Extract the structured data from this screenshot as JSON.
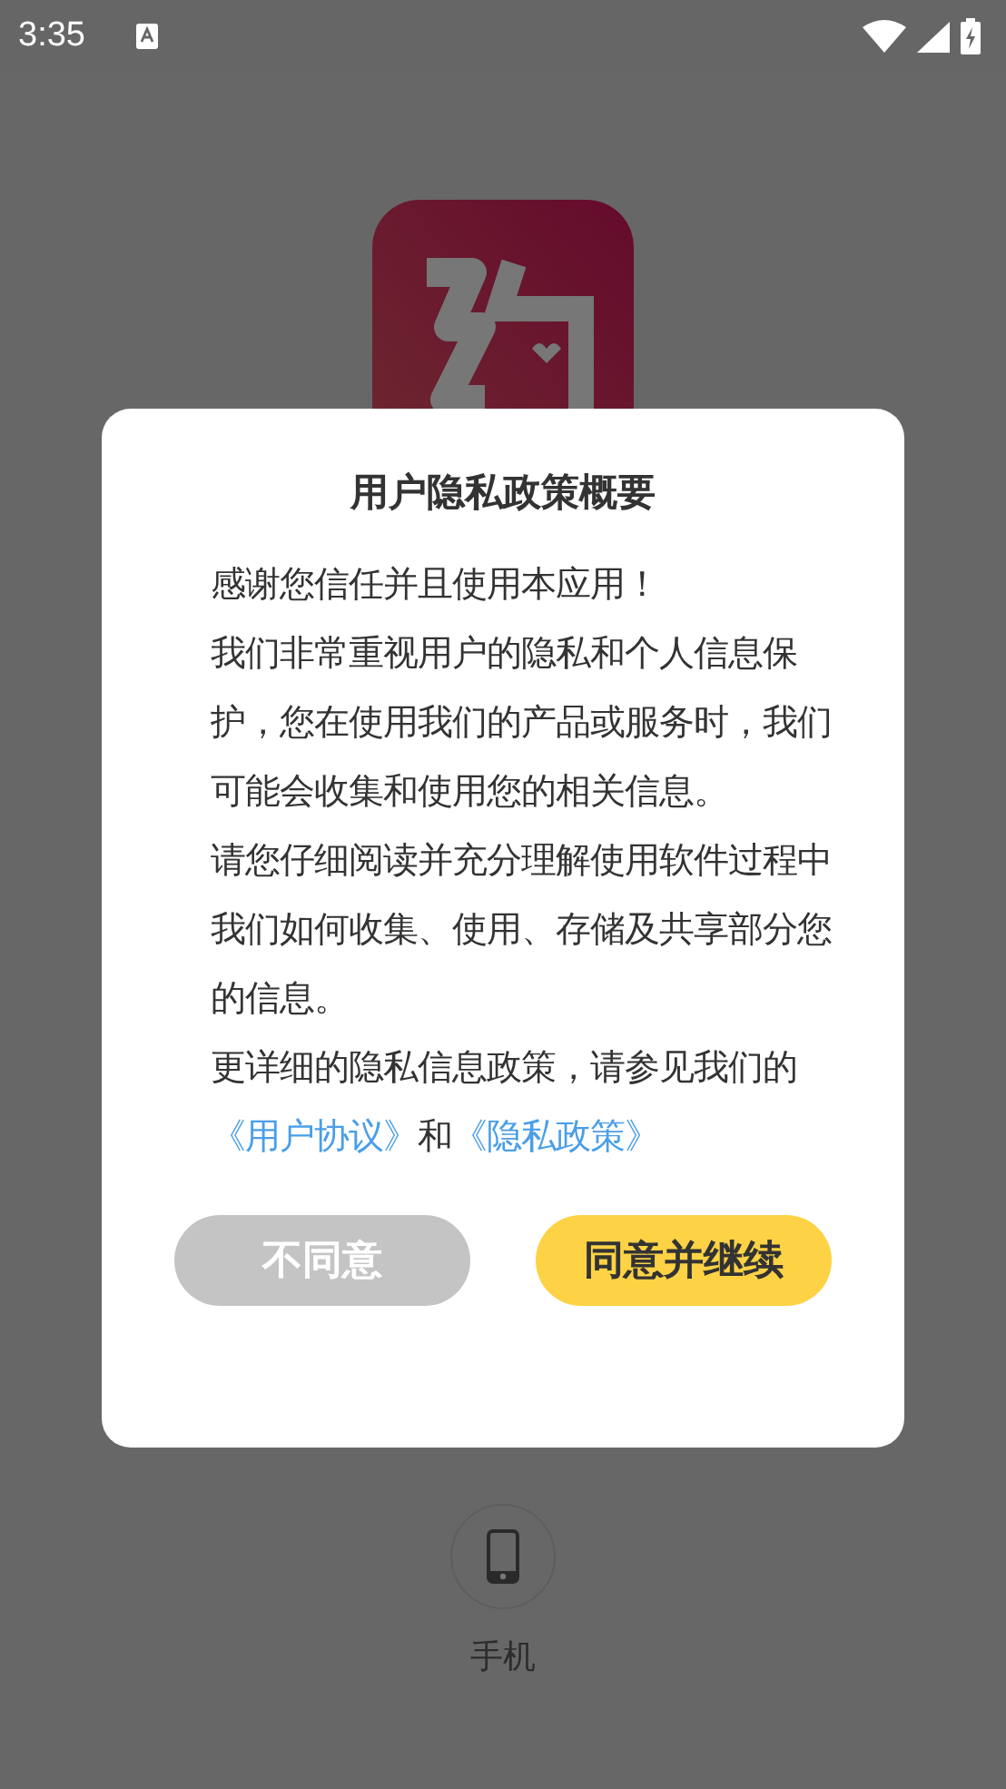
{
  "status_bar": {
    "time": "3:35"
  },
  "login": {
    "option_label": "手机"
  },
  "dialog": {
    "title": "用户隐私政策概要",
    "paragraphs": [
      "感谢您信任并且使用本应用！",
      "我们非常重视用户的隐私和个人信息保护，您在使用我们的产品或服务时，我们可能会收集和使用您的相关信息。",
      "请您仔细阅读并充分理解使用软件过程中我们如何收集、使用、存储及共享部分您的信息。"
    ],
    "closing": [
      {
        "kind": "text",
        "text": "更详细的隐私信息政策，请参见我们的"
      },
      {
        "kind": "link",
        "text": "《用户协议》"
      },
      {
        "kind": "text",
        "text": "和"
      },
      {
        "kind": "link",
        "text": "《隐私政策》"
      }
    ],
    "buttons": [
      {
        "label": "不同意",
        "kind": "decline"
      },
      {
        "label": "同意并继续",
        "kind": "accept"
      }
    ]
  }
}
